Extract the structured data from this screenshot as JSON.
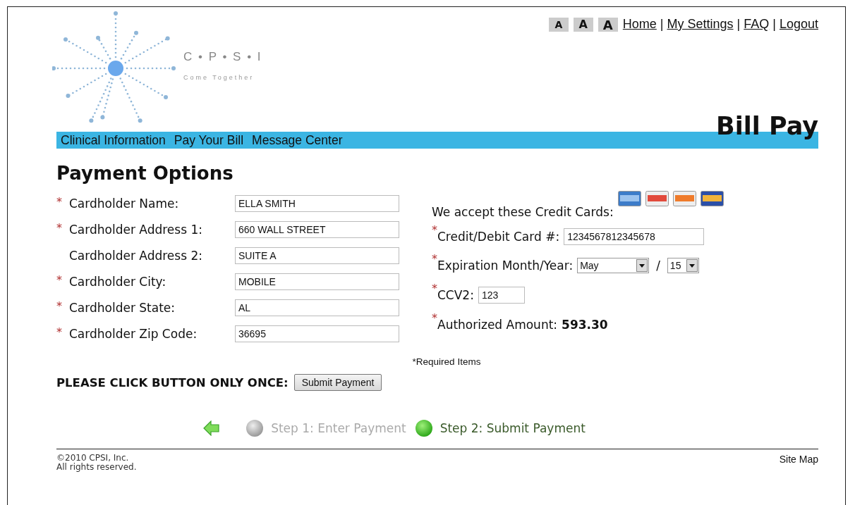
{
  "logo": {
    "name": "C • P • S • I",
    "tagline": "Come Together"
  },
  "font_size_buttons": [
    {
      "label": "A",
      "selected": false
    },
    {
      "label": "A",
      "selected": false
    },
    {
      "label": "A",
      "selected": false
    }
  ],
  "top_links": [
    "Home",
    "My Settings",
    "FAQ",
    "Logout"
  ],
  "link_separator": "|",
  "required_mark": "*",
  "page_title": "Bill Pay",
  "nav": [
    "Clinical Information",
    "Pay Your Bill",
    "Message Center"
  ],
  "heading": "Payment Options",
  "cardholder_fields": [
    {
      "label": "Cardholder Name:",
      "required": true,
      "value": "ELLA SMITH"
    },
    {
      "label": "Cardholder Address 1:",
      "required": true,
      "value": "660 WALL STREET"
    },
    {
      "label": "Cardholder Address 2:",
      "required": false,
      "value": "SUITE A"
    },
    {
      "label": "Cardholder City:",
      "required": true,
      "value": "MOBILE"
    },
    {
      "label": "Cardholder State:",
      "required": true,
      "value": "AL"
    },
    {
      "label": "Cardholder Zip Code:",
      "required": true,
      "value": "36695"
    }
  ],
  "accepted_cards_label": "We accept these Credit Cards:",
  "card_fields": [
    {
      "kind": "input",
      "label": "Credit/Debit Card #:",
      "required": true,
      "value": "1234567812345678"
    },
    {
      "kind": "expiry",
      "label": "Expiration Month/Year:",
      "required": true,
      "month": "May",
      "separator": "/",
      "year": "15"
    },
    {
      "kind": "short",
      "label": "CCV2:",
      "required": true,
      "value": "123"
    },
    {
      "kind": "amount",
      "label": "Authorized Amount:",
      "required": true,
      "value": "593.30"
    }
  ],
  "required_note": "*Required Items",
  "click_note": "PLEASE CLICK BUTTON ONLY ONCE:",
  "submit_button": "Submit Payment",
  "steps": [
    {
      "label": "Step 1: Enter Payment",
      "active": false
    },
    {
      "label": "Step 2: Submit Payment",
      "active": true
    }
  ],
  "footer": {
    "copyright": "©2010 CPSI, Inc.",
    "rights": "All rights reserved.",
    "site_map": "Site Map"
  }
}
